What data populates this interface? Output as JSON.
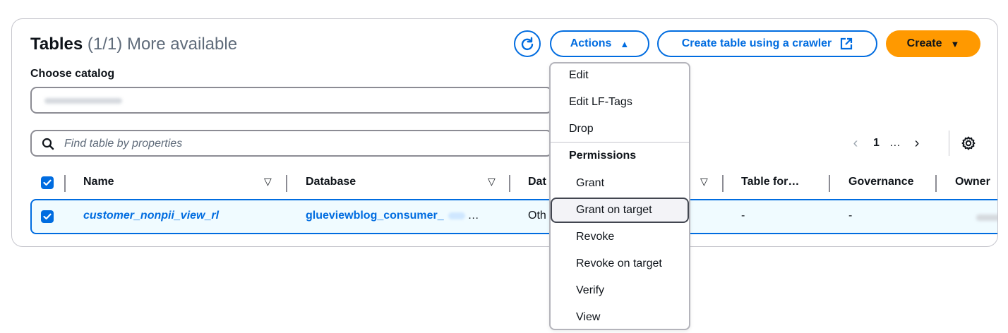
{
  "header": {
    "title": "Tables",
    "count": "(1/1)",
    "more": "More available"
  },
  "catalog": {
    "label": "Choose catalog"
  },
  "search": {
    "placeholder": "Find table by properties"
  },
  "toolbar": {
    "refresh_icon": "refresh-icon",
    "actions_label": "Actions",
    "actions_caret": "▲",
    "crawler_label": "Create table using a crawler",
    "crawler_icon": "external-link-icon",
    "create_label": "Create",
    "create_caret": "▼"
  },
  "pagination": {
    "prev": "‹",
    "page": "1",
    "ellipsis": "…",
    "next": "›",
    "settings_icon": "gear-icon"
  },
  "table": {
    "columns": [
      "Name",
      "Database",
      "Dat",
      "Table for…",
      "Governance",
      "Owner"
    ],
    "rows": [
      {
        "name": "customer_nonpii_view_rl",
        "database": "glueviewblog_consumer_",
        "database_ellipsis": "…",
        "data_location": "Oth",
        "table_format": "-",
        "governance": "-"
      }
    ]
  },
  "actions_menu": {
    "items": [
      "Edit",
      "Edit LF-Tags",
      "Drop"
    ],
    "group_label": "Permissions",
    "permission_items": [
      "Grant",
      "Grant on target",
      "Revoke",
      "Revoke on target",
      "Verify",
      "View"
    ],
    "highlighted": "Grant on target"
  },
  "colors": {
    "accent": "#006ce0",
    "create_button": "#ff9900",
    "selected_row_bg": "#f0fbff",
    "text": "#0f141a",
    "muted": "#5f6b7a"
  }
}
